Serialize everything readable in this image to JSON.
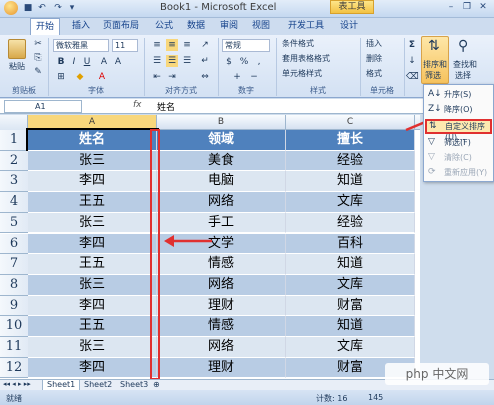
{
  "title_bar": {
    "title": "Book1 - Microsoft Excel",
    "context_tab": "表工具"
  },
  "tabs": [
    "开始",
    "插入",
    "页面布局",
    "公式",
    "数据",
    "审阅",
    "视图",
    "开发工具",
    "设计"
  ],
  "ribbon": {
    "paste_label": "粘贴",
    "clipboard_label": "剪贴板",
    "font_name": "微软雅黑",
    "font_size": "11",
    "font_label": "字体",
    "alignment_label": "对齐方式",
    "number_format": "常规",
    "number_label": "数字",
    "style_items": [
      "条件格式",
      "套用表格格式",
      "单元格样式"
    ],
    "style_label": "样式",
    "cell_items": [
      "插入",
      "删除",
      "格式"
    ],
    "cells_label": "单元格",
    "sort_filter_line1": "排序和",
    "sort_filter_line2": "筛选",
    "find_select_line1": "查找和",
    "find_select_line2": "选择"
  },
  "formula_bar": {
    "name_box": "A1",
    "fx": "fx",
    "content": "姓名"
  },
  "columns": [
    "A",
    "B",
    "C"
  ],
  "rows": [
    "1",
    "2",
    "3",
    "4",
    "5",
    "6",
    "7",
    "8",
    "9",
    "10",
    "11",
    "12"
  ],
  "table": {
    "headers": [
      "姓名",
      "领域",
      "擅长"
    ],
    "cells": [
      [
        "张三",
        "美食",
        "经验"
      ],
      [
        "李四",
        "电脑",
        "知道"
      ],
      [
        "王五",
        "网络",
        "文库"
      ],
      [
        "张三",
        "手工",
        "经验"
      ],
      [
        "李四",
        "文学",
        "百科"
      ],
      [
        "王五",
        "情感",
        "知道"
      ],
      [
        "张三",
        "网络",
        "文库"
      ],
      [
        "李四",
        "理财",
        "财富"
      ],
      [
        "王五",
        "情感",
        "知道"
      ],
      [
        "张三",
        "网络",
        "文库"
      ],
      [
        "李四",
        "理财",
        "财富"
      ]
    ]
  },
  "sort_menu": {
    "items": [
      "升序(S)",
      "降序(O)",
      "自定义排序(U)...",
      "筛选(F)",
      "清除(C)",
      "重新应用(Y)"
    ]
  },
  "sheets": [
    "Sheet1",
    "Sheet2",
    "Sheet3"
  ],
  "status": {
    "ready": "就绪",
    "count": "计数: 16",
    "zoom": "145"
  },
  "watermark": "php 中文网",
  "colors": {
    "header_fill": "#4f81bd",
    "band_dark": "#b8cce4",
    "band_light": "#dce6f1",
    "highlight": "#e03030"
  }
}
